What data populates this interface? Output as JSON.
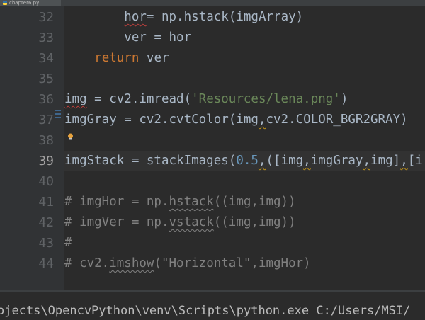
{
  "editor_tab": {
    "filename": "chapter6.py"
  },
  "code_lines": [
    {
      "number": "32",
      "active": false
    },
    {
      "number": "33",
      "active": false
    },
    {
      "number": "34",
      "active": false
    },
    {
      "number": "35",
      "active": false
    },
    {
      "number": "36",
      "active": false
    },
    {
      "number": "37",
      "active": false
    },
    {
      "number": "38",
      "active": false
    },
    {
      "number": "39",
      "active": true
    },
    {
      "number": "40",
      "active": false
    },
    {
      "number": "41",
      "active": false
    },
    {
      "number": "42",
      "active": false
    },
    {
      "number": "43",
      "active": false
    },
    {
      "number": "44",
      "active": false
    }
  ],
  "code": {
    "l32": {
      "a": "hor",
      "b": "=",
      "c": " np.hstack(imgArray)"
    },
    "l33": {
      "text": "ver = hor"
    },
    "l34": {
      "kw": "return",
      "rest": " ver"
    },
    "l36": {
      "a": "img",
      "b": " = cv2.imread(",
      "str": "'Resources/lena.png'",
      "c": ")"
    },
    "l37": {
      "a": "imgGray = cv2.cvtColor(img",
      "b": ",",
      "c": "cv2.COLOR_BGR2GRAY)"
    },
    "l39": {
      "a": "imgStack = stackImages(",
      "num": "0.5",
      "b": ",",
      "c": "([img",
      "d": ",",
      "e": "imgGray",
      "f": ",",
      "g": "img]",
      "h": ",",
      "i": "[i"
    },
    "l41": {
      "a": "# imgHor = np.",
      "b": "hstack",
      "c": "((img,img))"
    },
    "l42": {
      "a": "# imgVer = np.",
      "b": "vstack",
      "c": "((img,img))"
    },
    "l43": {
      "text": "#"
    },
    "l44": {
      "a": "# cv2.",
      "b": "imshow",
      "c": "(\"Horizontal\",imgHor)"
    }
  },
  "console": {
    "command": "ojects\\OpencvPython\\venv\\Scripts\\python.exe C:/Users/MSI/"
  },
  "colors": {
    "background": "#2b2b2b",
    "keyword": "#cc7832",
    "string": "#6a8759",
    "number": "#6897bb",
    "comment": "#808080",
    "default_text": "#a9b7c6",
    "error_underline": "#bc3f3c"
  },
  "icons": {
    "tab": "python-file-icon",
    "gutter": "lightbulb-icon"
  }
}
